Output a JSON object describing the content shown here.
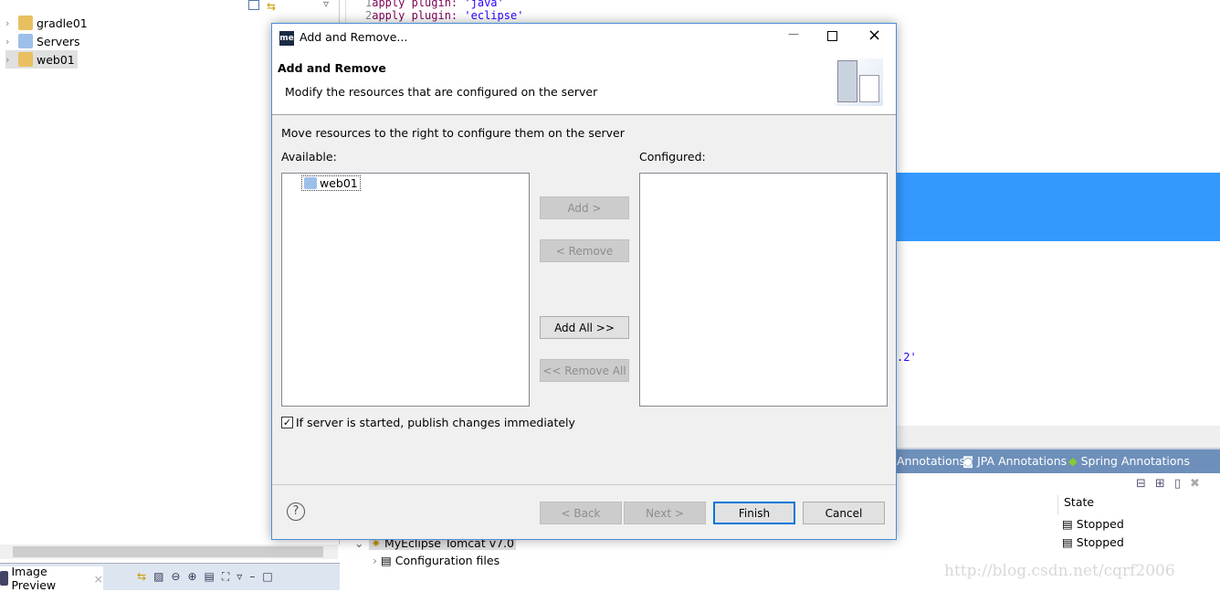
{
  "explorer": {
    "items": [
      {
        "label": "gradle01"
      },
      {
        "label": "Servers"
      },
      {
        "label": "web01"
      }
    ]
  },
  "editor": {
    "lines": [
      {
        "num": "1",
        "kw": "apply plugin: ",
        "str": "'java'"
      },
      {
        "num": "2",
        "kw": "apply plugin: ",
        "str": "'eclipse'"
      }
    ],
    "partial": ".2'"
  },
  "bottom_tabs": [
    "Annotations",
    "JPA Annotations",
    "Spring Annotations"
  ],
  "servers": {
    "state_header": "State",
    "rows": [
      {
        "name": "",
        "state": "Stopped"
      },
      {
        "name": "MyEclipse Tomcat v7.0",
        "state": "Stopped"
      }
    ],
    "child": "Configuration files"
  },
  "image_preview": {
    "tab": "Image Preview"
  },
  "watermark": "http://blog.csdn.net/cqrf2006",
  "dialog": {
    "title": "Add and Remove...",
    "app_badge": "me",
    "header_title": "Add and Remove",
    "header_desc": "Modify the resources that are configured on the server",
    "instruction": "Move resources to the right to configure them on the server",
    "available_label": "Available:",
    "configured_label": "Configured:",
    "available_items": [
      "web01"
    ],
    "configured_items": [],
    "buttons": {
      "add": "Add >",
      "remove": "< Remove",
      "add_all": "Add All >>",
      "remove_all": "<< Remove All",
      "back": "< Back",
      "next": "Next >",
      "finish": "Finish",
      "cancel": "Cancel"
    },
    "publish_checkbox": {
      "label": "If server is started, publish changes immediately",
      "checked": true
    },
    "help": "?"
  },
  "colors": {
    "accent": "#0078d7",
    "selection": "#3399ff",
    "tabbar": "#6d8fba"
  }
}
